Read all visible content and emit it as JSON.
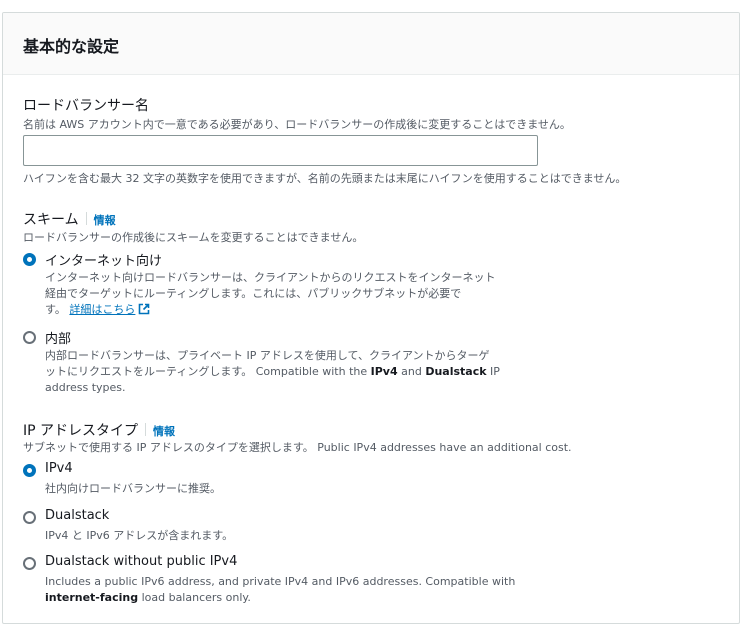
{
  "section": {
    "title": "基本的な設定"
  },
  "lb_name": {
    "label": "ロードバランサー名",
    "description": "名前は AWS アカウント内で一意である必要があり、ロードバランサーの作成後に変更することはできません。",
    "value": "",
    "placeholder": "",
    "constraint": "ハイフンを含む最大 32 文字の英数字を使用できますが、名前の先頭または末尾にハイフンを使用することはできません。"
  },
  "scheme": {
    "label": "スキーム",
    "info": "情報",
    "description": "ロードバランサーの作成後にスキームを変更することはできません。",
    "options": [
      {
        "label": "インターネット向け",
        "checked": true,
        "desc_line1": "インターネット向けロードバランサーは、クライアントからのリクエストをインターネット",
        "desc_line2": "経由でターゲットにルーティングします。これには、パブリックサブネットが必要で",
        "desc_line3_prefix": "す。",
        "link": "詳細はこちら",
        "link_icon": "external-link-icon"
      },
      {
        "label": "内部",
        "checked": false,
        "desc_line1": "内部ロードバランサーは、プライベート IP アドレスを使用して、クライアントからターゲ",
        "desc_line2_prefix": "ットにリクエストをルーティングします。 Compatible with the ",
        "bold1": "IPv4",
        "and": " and ",
        "bold2": "Dualstack",
        "suffix": " IP",
        "desc_line3": "address types."
      }
    ]
  },
  "ip_type": {
    "label": "IP アドレスタイプ",
    "info": "情報",
    "description": "サブネットで使用する IP アドレスのタイプを選択します。 Public IPv4 addresses have an additional cost.",
    "options": [
      {
        "label": "IPv4",
        "checked": true,
        "desc": "社内向けロードバランサーに推奨。"
      },
      {
        "label": "Dualstack",
        "checked": false,
        "desc": "IPv4 と IPv6 アドレスが含まれます。"
      },
      {
        "label": "Dualstack without public IPv4",
        "checked": false,
        "desc_line1": "Includes a public IPv6 address, and private IPv4 and IPv6 addresses. Compatible with",
        "bold": "internet-facing",
        "desc_line2_suffix": " load balancers only."
      }
    ]
  },
  "colors": {
    "accent": "#0073bb",
    "text": "#16191f",
    "secondary": "#545b64"
  }
}
